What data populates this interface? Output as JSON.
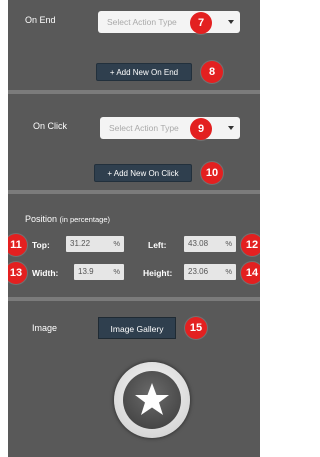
{
  "colors": {
    "panel_bg": "#595959",
    "divider": "#7b7b7b",
    "badge_red": "#e32020",
    "button_dark": "#2f3f4e"
  },
  "on_end": {
    "label": "On End",
    "select_placeholder": "Select Action Type",
    "add_button": "+ Add New On End",
    "badge_select": "7",
    "badge_add": "8"
  },
  "on_click": {
    "label": "On Click",
    "select_placeholder": "Select Action Type",
    "add_button": "+ Add New On Click",
    "badge_select": "9",
    "badge_add": "10"
  },
  "position": {
    "title": "Position",
    "subtitle": "(in percentage)",
    "top_label": "Top:",
    "top_value": "31.22",
    "left_label": "Left:",
    "left_value": "43.08",
    "width_label": "Width:",
    "width_value": "13.9",
    "height_label": "Height:",
    "height_value": "23.06",
    "unit": "%",
    "badge_top": "11",
    "badge_left": "12",
    "badge_width": "13",
    "badge_height": "14"
  },
  "image": {
    "label": "Image",
    "gallery_button": "Image Gallery",
    "badge_gallery": "15",
    "preview_icon": "star-icon"
  }
}
